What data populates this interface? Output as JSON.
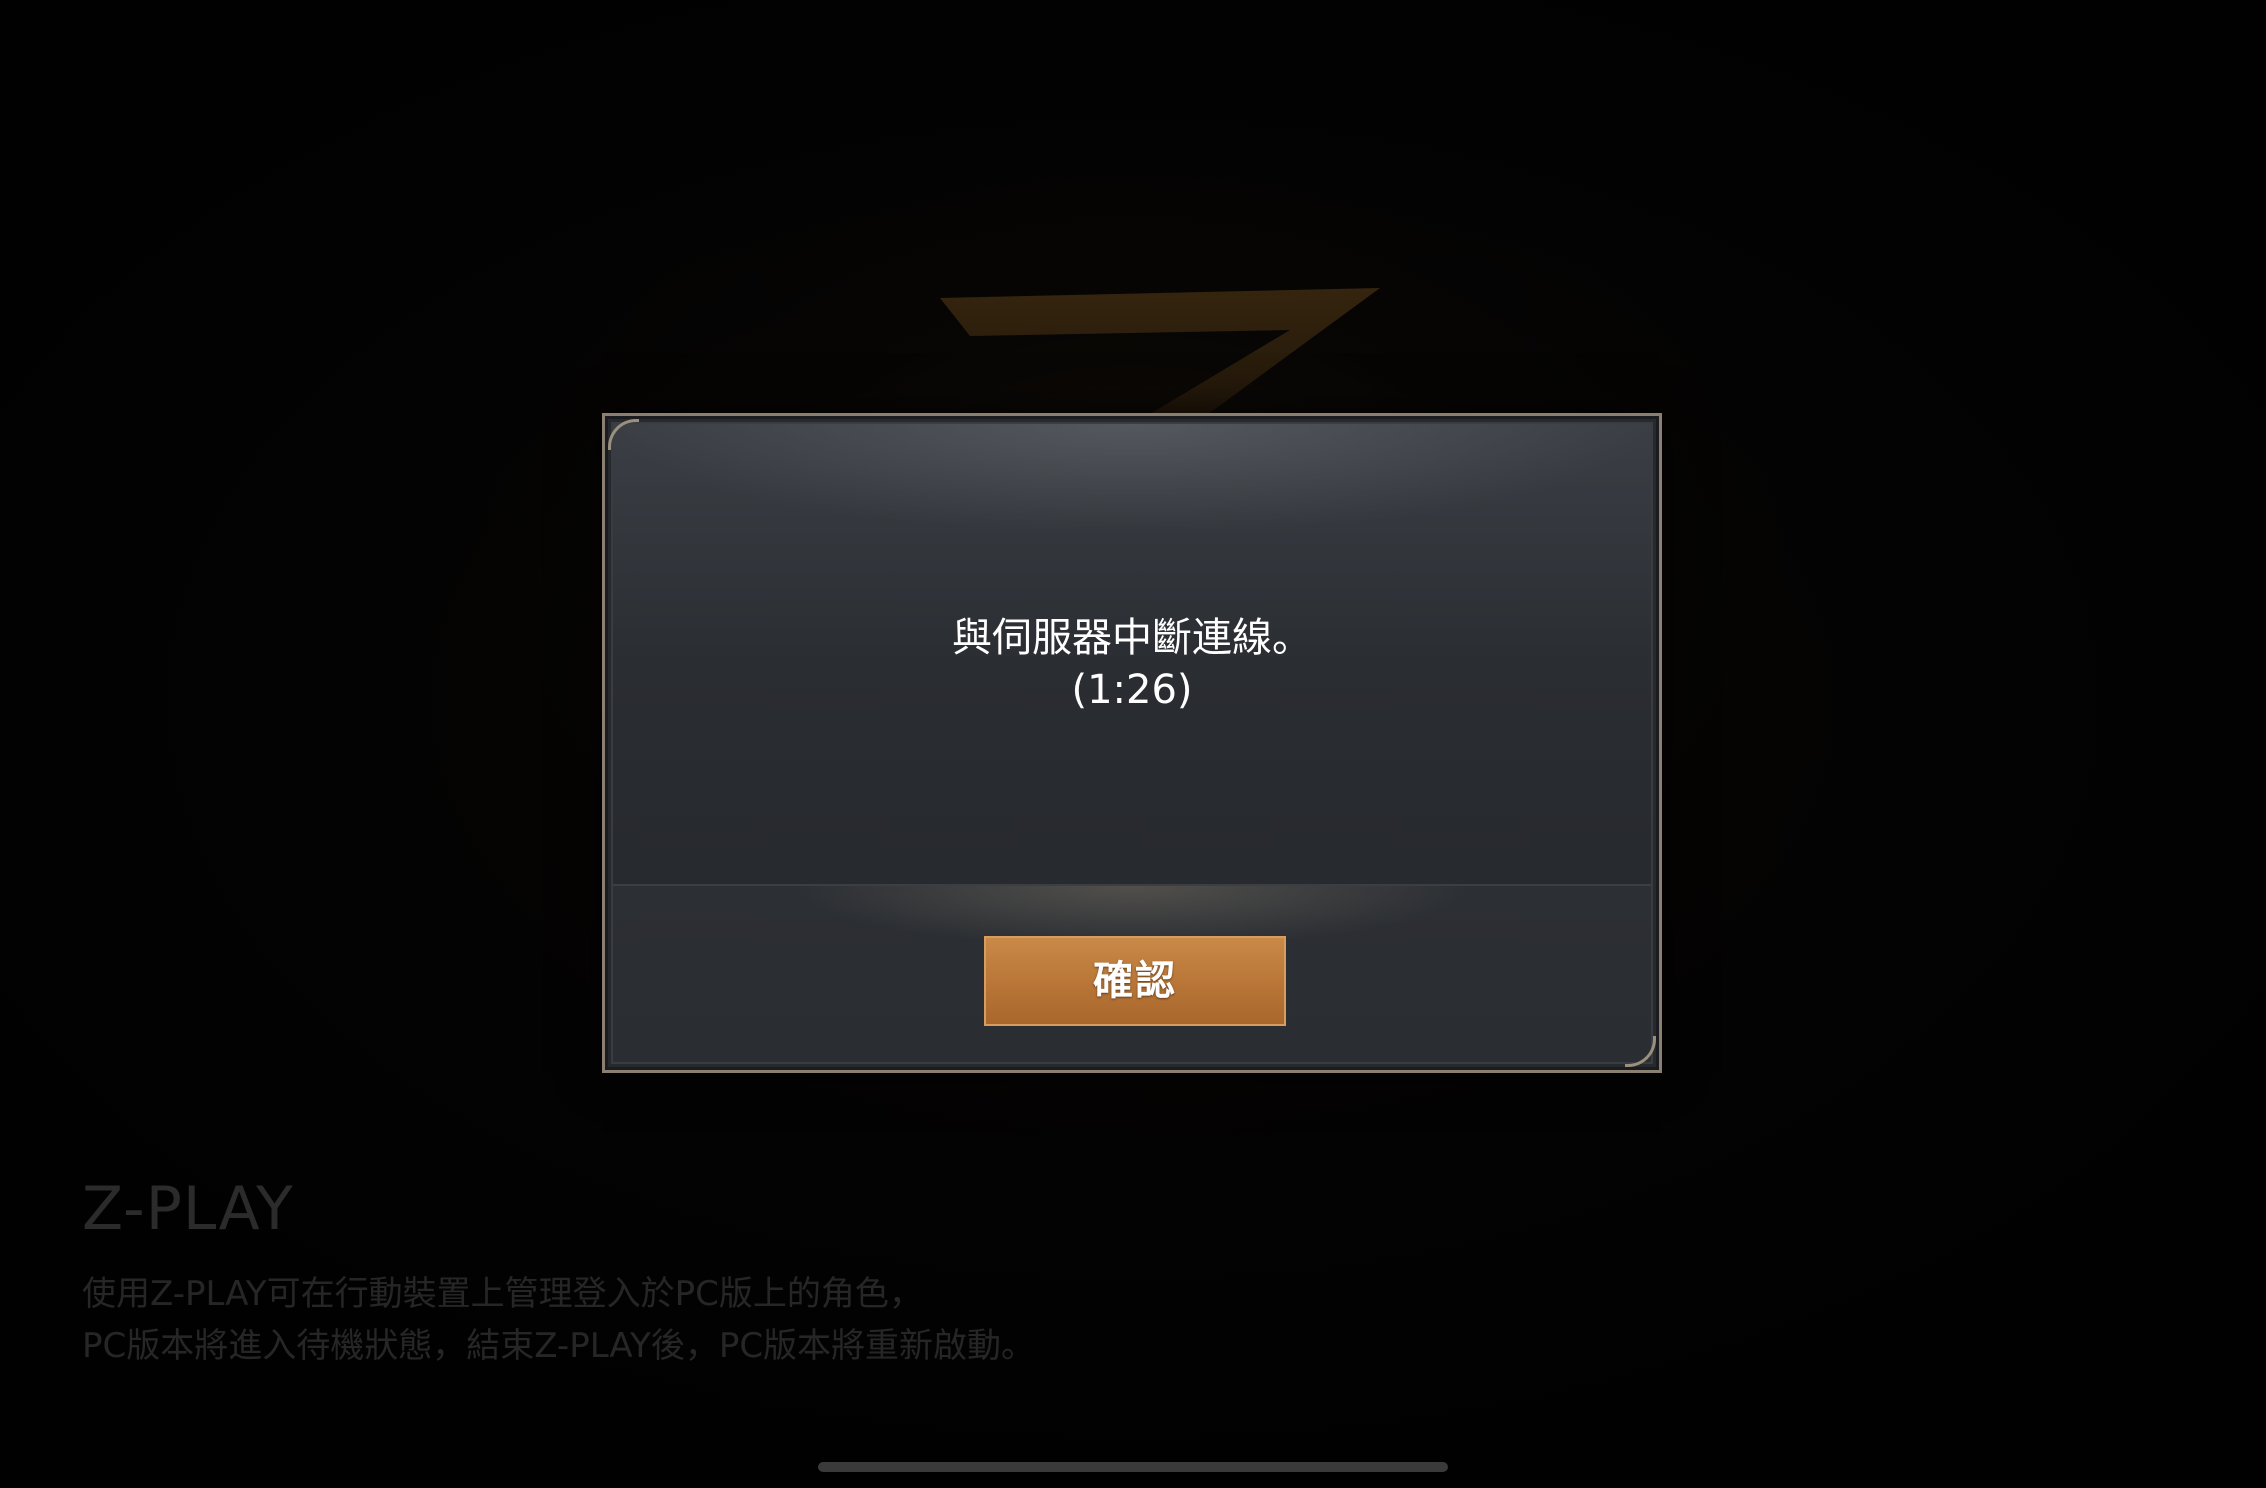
{
  "background": {
    "logo_icon": "z-emblem-icon",
    "info_title": "Z-PLAY",
    "info_lines": [
      "使用Z-PLAY可在行動裝置上管理登入於PC版上的角色，",
      "PC版本將進入待機狀態，結束Z-PLAY後，PC版本將重新啟動。"
    ]
  },
  "dialog": {
    "message_line1": "與伺服器中斷連線。",
    "message_line2": "(1:26)",
    "confirm_label": "確認"
  },
  "colors": {
    "accent_button": "#b87537",
    "dialog_border": "#8a7f70",
    "dialog_bg": "#26292e"
  }
}
